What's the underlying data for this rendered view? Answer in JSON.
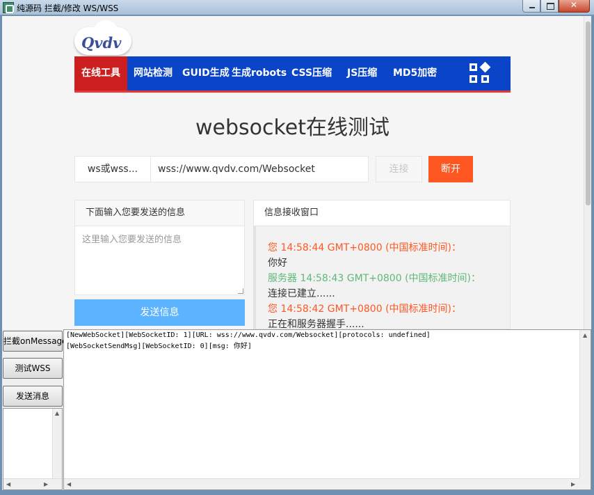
{
  "window": {
    "title": "纯源码 拦截/修改 WS/WSS"
  },
  "site": {
    "logo_text": "Qvdv",
    "nav": [
      {
        "label": "在线工具",
        "active": true
      },
      {
        "label": "网站检测",
        "active": false
      },
      {
        "label": "GUID生成",
        "active": false
      },
      {
        "label": "生成robots",
        "active": false
      },
      {
        "label": "CSS压缩",
        "active": false
      },
      {
        "label": "JS压缩",
        "active": false
      },
      {
        "label": "MD5加密",
        "active": false
      }
    ],
    "nav_icon": "grid-icon",
    "page_title": "websocket在线测试",
    "protocol_selector": "ws或wss...",
    "url_value": "wss://www.qvdv.com/Websocket",
    "connect_label": "连接",
    "disconnect_label": "断开",
    "send_panel_title": "下面输入您要发送的信息",
    "send_placeholder": "这里输入您要发送的信息",
    "send_button": "发送信息",
    "receive_title": "信息接收窗口",
    "messages": [
      {
        "kind": "me",
        "text": "您 14:58:44 GMT+0800 (中国标准时间)："
      },
      {
        "kind": "body",
        "text": "你好"
      },
      {
        "kind": "server",
        "text": "服务器 14:58:43 GMT+0800 (中国标准时间)："
      },
      {
        "kind": "body",
        "text": "连接已建立......"
      },
      {
        "kind": "me",
        "text": "您 14:58:42 GMT+0800 (中国标准时间)："
      },
      {
        "kind": "body",
        "text": "正在和服务器握手......"
      }
    ],
    "colors": {
      "nav_bg": "#0a44c9",
      "nav_active": "#cc1e1e",
      "disconnect": "#ff5722",
      "send_button": "#5cb3ff",
      "server_msg": "#5fb878"
    }
  },
  "controls": {
    "intercept_button": "拦截onMessage",
    "test_button": "测试WSS",
    "send_button": "发送消息"
  },
  "log": {
    "lines": [
      "[NewWebSocket][WebSocketID: 1][URL: wss://www.qvdv.com/Websocket][protocols: undefined]",
      "[WebSocketSendMsg][WebSocketID: 0][msg: 你好]"
    ]
  }
}
